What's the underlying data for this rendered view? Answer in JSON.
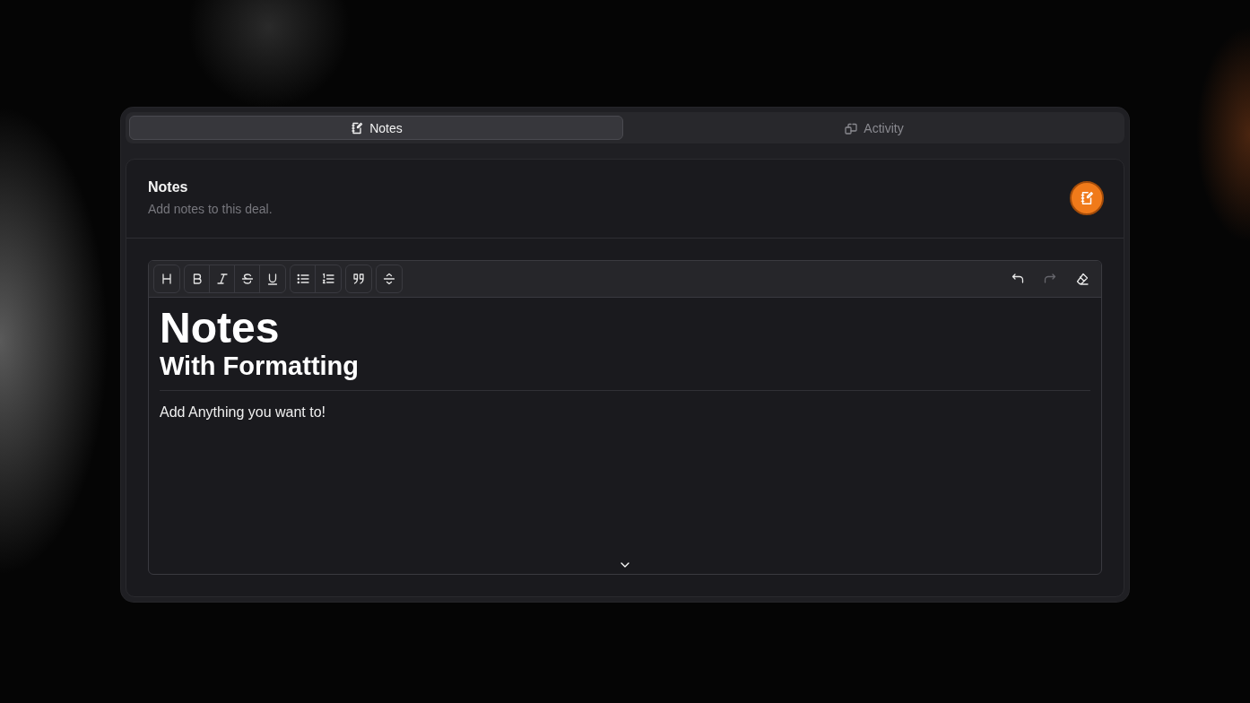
{
  "tabs": [
    {
      "label": "Notes",
      "kind": "notes",
      "selected": true
    },
    {
      "label": "Activity",
      "kind": "activity",
      "selected": false
    }
  ],
  "header": {
    "title": "Notes",
    "subtitle": "Add notes to this deal."
  },
  "toolbar": {
    "groups": [
      [
        {
          "kind": "heading"
        }
      ],
      [
        {
          "kind": "bold"
        },
        {
          "kind": "italic"
        },
        {
          "kind": "strike"
        },
        {
          "kind": "underline"
        }
      ],
      [
        {
          "kind": "bullet-list"
        },
        {
          "kind": "ordered-list"
        }
      ],
      [
        {
          "kind": "quote"
        }
      ],
      [
        {
          "kind": "divider"
        }
      ]
    ],
    "history": [
      {
        "kind": "undo",
        "disabled": false
      },
      {
        "kind": "redo",
        "disabled": true
      },
      {
        "kind": "clear",
        "disabled": false
      }
    ]
  },
  "editor": {
    "blocks": [
      {
        "kind": "h1",
        "text": "Notes"
      },
      {
        "kind": "h2",
        "text": "With Formatting"
      },
      {
        "kind": "hr"
      },
      {
        "kind": "p",
        "text": "Add Anything you want to!"
      }
    ]
  }
}
